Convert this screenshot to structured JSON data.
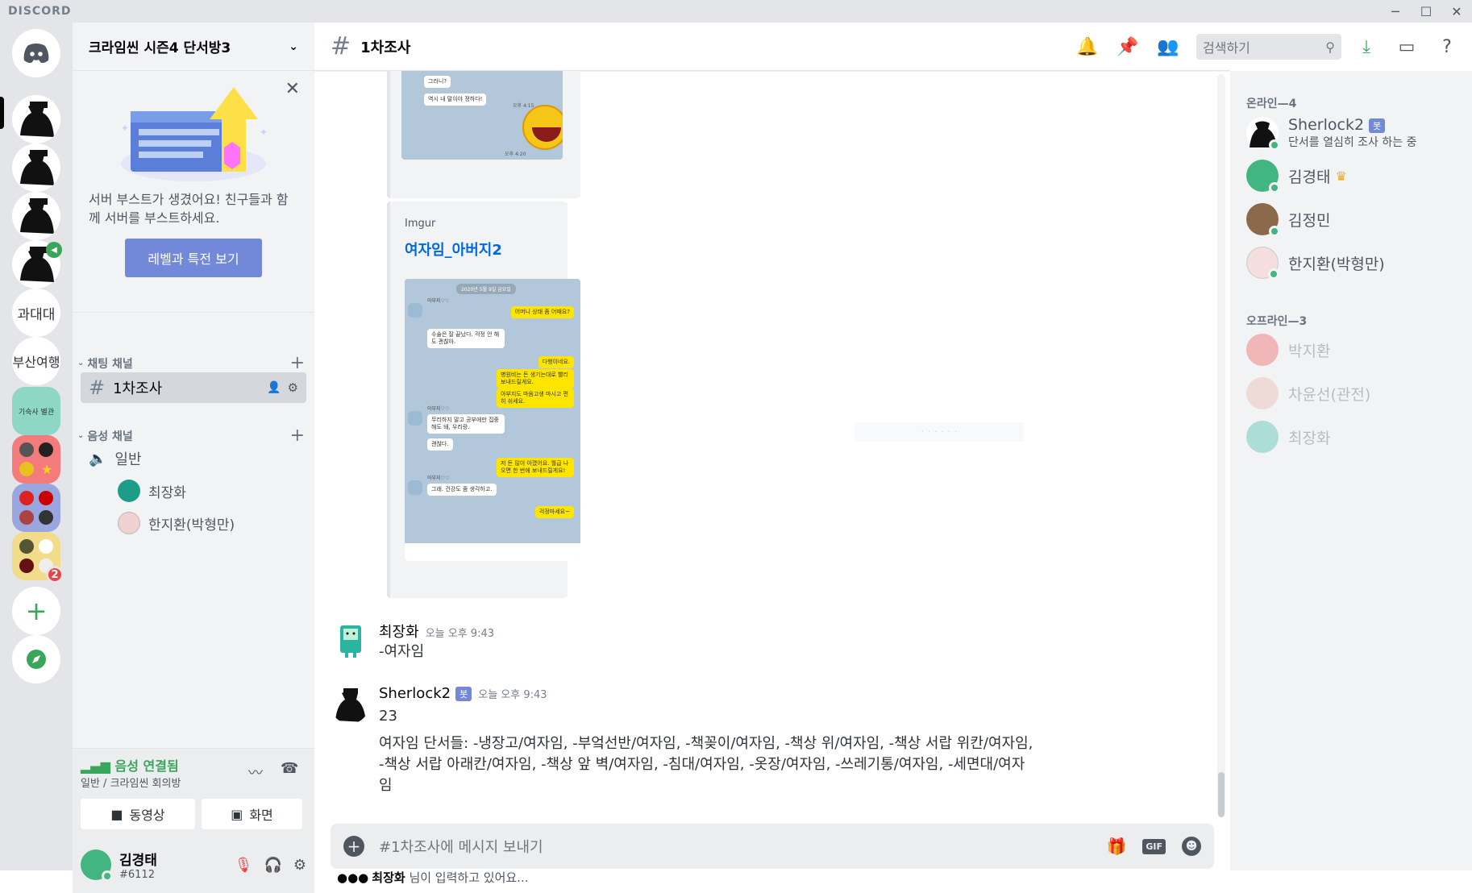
{
  "app": {
    "brand": "DISCORD"
  },
  "window": {
    "min": "─",
    "max": "☐",
    "close": "✕"
  },
  "servers": [
    {
      "name": "sherlock-server-1"
    },
    {
      "name": "sherlock-server-2"
    },
    {
      "name": "sherlock-server-3"
    },
    {
      "name": "sherlock-server-4"
    },
    {
      "label": "과대대"
    },
    {
      "label": "부산여행"
    },
    {
      "label": "기숙사 별관"
    },
    {
      "name": "group-server-6"
    },
    {
      "name": "group-server-7"
    },
    {
      "name": "group-server-8",
      "badge": "2"
    }
  ],
  "guild": {
    "name": "크라임씬 시즌4 단서방3"
  },
  "boost": {
    "text": "서버 부스트가 생겼어요! 친구들과 함께 서버를 부스트하세요.",
    "button": "레벨과 특전 보기"
  },
  "categories": {
    "text": "채팅 채널",
    "voice": "음성 채널"
  },
  "channels": {
    "text": [
      {
        "name": "1차조사"
      }
    ],
    "voice": [
      {
        "name": "일반"
      }
    ]
  },
  "voice_users": [
    "최장화",
    "한지환(박형만)"
  ],
  "voice_panel": {
    "status": "음성 연결됨",
    "location": "일반 / 크라임씬 회의방",
    "video": "동영상",
    "screen": "화면"
  },
  "user": {
    "name": "김경태",
    "tag": "#6112"
  },
  "chat": {
    "channel": "1차조사",
    "search_placeholder": "검색하기",
    "embed_small_msgs": [
      "그러니?",
      "역시 내 말이야 정하다!",
      "오후 4:15",
      "오후 4:20"
    ],
    "embed": {
      "provider": "Imgur",
      "title": "여자임_아버지2"
    },
    "kakao": [
      {
        "t": "2020년 5월 9일 금요일",
        "k": "d"
      },
      {
        "t": "어머니 상태 좀 어때요?",
        "k": "y"
      },
      {
        "t": "수술은 잘 끝났다. 걱정 안 해도 괜찮아.",
        "k": "w"
      },
      {
        "t": "다행이네요.",
        "k": "y"
      },
      {
        "t": "병원비는 돈 생기는대로 빨리 보내드릴게요.",
        "k": "y"
      },
      {
        "t": "아부지도 마음고생 마시고 편히 쉬세요.",
        "k": "y"
      },
      {
        "t": "무리하지 말고 공부에만 집중해도 돼, 우리랑.",
        "k": "w"
      },
      {
        "t": "괜찮다.",
        "k": "w"
      },
      {
        "t": "저 돈 많이 아꼈어요. 월급 나오면 한 번에 보내드릴게요!",
        "k": "y"
      },
      {
        "t": "그래. 건강도 좀 생각하고.",
        "k": "w"
      },
      {
        "t": "걱정마세요~",
        "k": "y"
      }
    ],
    "kakao_sender": "아부지♡♡",
    "messages": [
      {
        "author": "최장화",
        "time": "오늘 오후 9:43",
        "lines": [
          "-여자임"
        ]
      },
      {
        "author": "Sherlock2",
        "bot": "봇",
        "time": "오늘 오후 9:43",
        "lines": [
          "23",
          "여자임 단서들: -냉장고/여자임, -부엌선반/여자임, -책꽂이/여자임, -책상 위/여자임, -책상 서랍 위칸/여자임,",
          "-책상 서랍 아래칸/여자임, -책상 앞 벽/여자임, -침대/여자임, -옷장/여자임, -쓰레기통/여자임, -세면대/여자",
          "임"
        ]
      }
    ],
    "composer_placeholder": "#1차조사에 메시지 보내기",
    "typing": {
      "user": "최장화",
      "suffix": " 님이 입력하고 있어요..."
    }
  },
  "members": {
    "online_header": "온라인—4",
    "offline_header": "오프라인—3",
    "online": [
      {
        "name": "Sherlock2",
        "bot": "봇",
        "activity": "단서를 열심히 조사 하는 중"
      },
      {
        "name": "김경태",
        "crown": "♛"
      },
      {
        "name": "김정민"
      },
      {
        "name": "한지환(박형만)"
      }
    ],
    "offline": [
      {
        "name": "박지환"
      },
      {
        "name": "차윤선(관전)"
      },
      {
        "name": "최장화"
      }
    ]
  },
  "colors": {
    "blurple": "#7289da",
    "green": "#43b581",
    "link": "#0068e0",
    "voice_green": "#3ba55c"
  }
}
